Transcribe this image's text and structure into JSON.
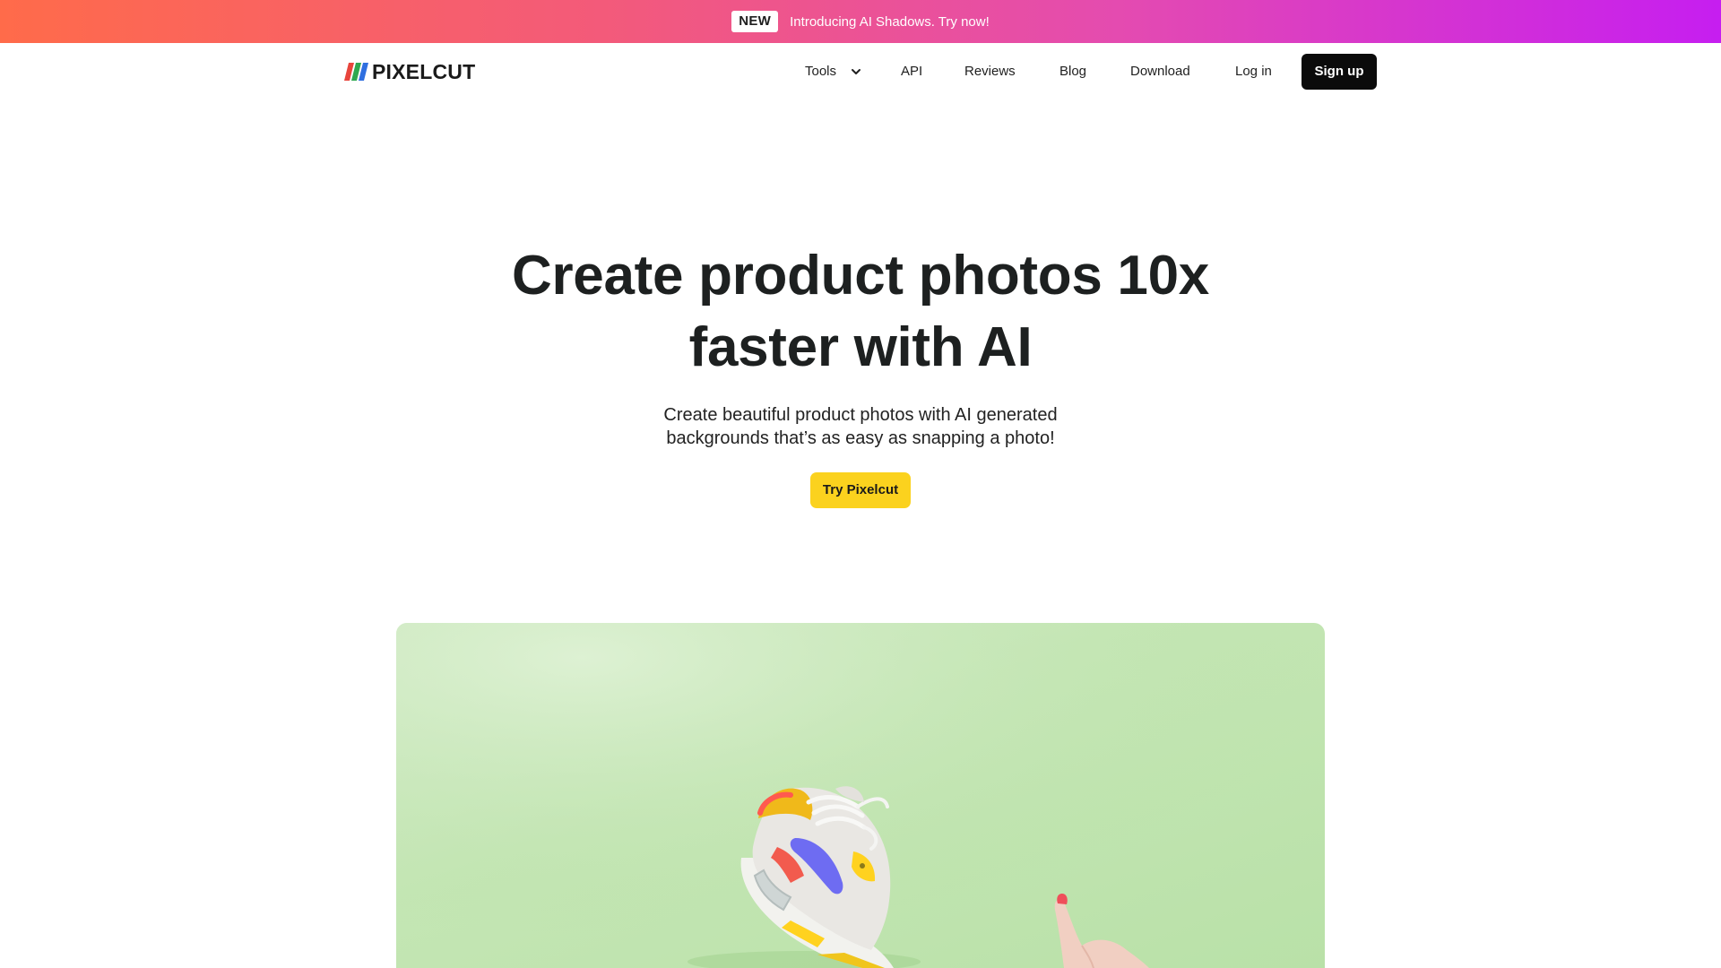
{
  "banner": {
    "badge": "NEW",
    "text": "Introducing AI Shadows. Try now!",
    "gradient": [
      "#ff6b4a",
      "#f35a7a",
      "#e44bb0",
      "#c61ef0"
    ]
  },
  "header": {
    "logo_text": "PIXELCUT",
    "logo_colors": [
      "#e8453c",
      "#2ea84f",
      "#2f6fe0"
    ],
    "nav": {
      "tools": "Tools",
      "api": "API",
      "reviews": "Reviews",
      "blog": "Blog",
      "download": "Download",
      "login": "Log in"
    },
    "signup_label": "Sign up"
  },
  "hero": {
    "title_line1": "Create product photos 10x",
    "title_line2": "faster with AI",
    "subtitle_line1": "Create beautiful product photos with AI generated",
    "subtitle_line2": "backgrounds that’s as easy as snapping a photo!",
    "cta_label": "Try Pixelcut",
    "cta_color": "#fbd21e"
  },
  "showcase": {
    "background_color": "#c4e6b4",
    "icons": [
      "sneaker-image",
      "hand-image"
    ]
  }
}
